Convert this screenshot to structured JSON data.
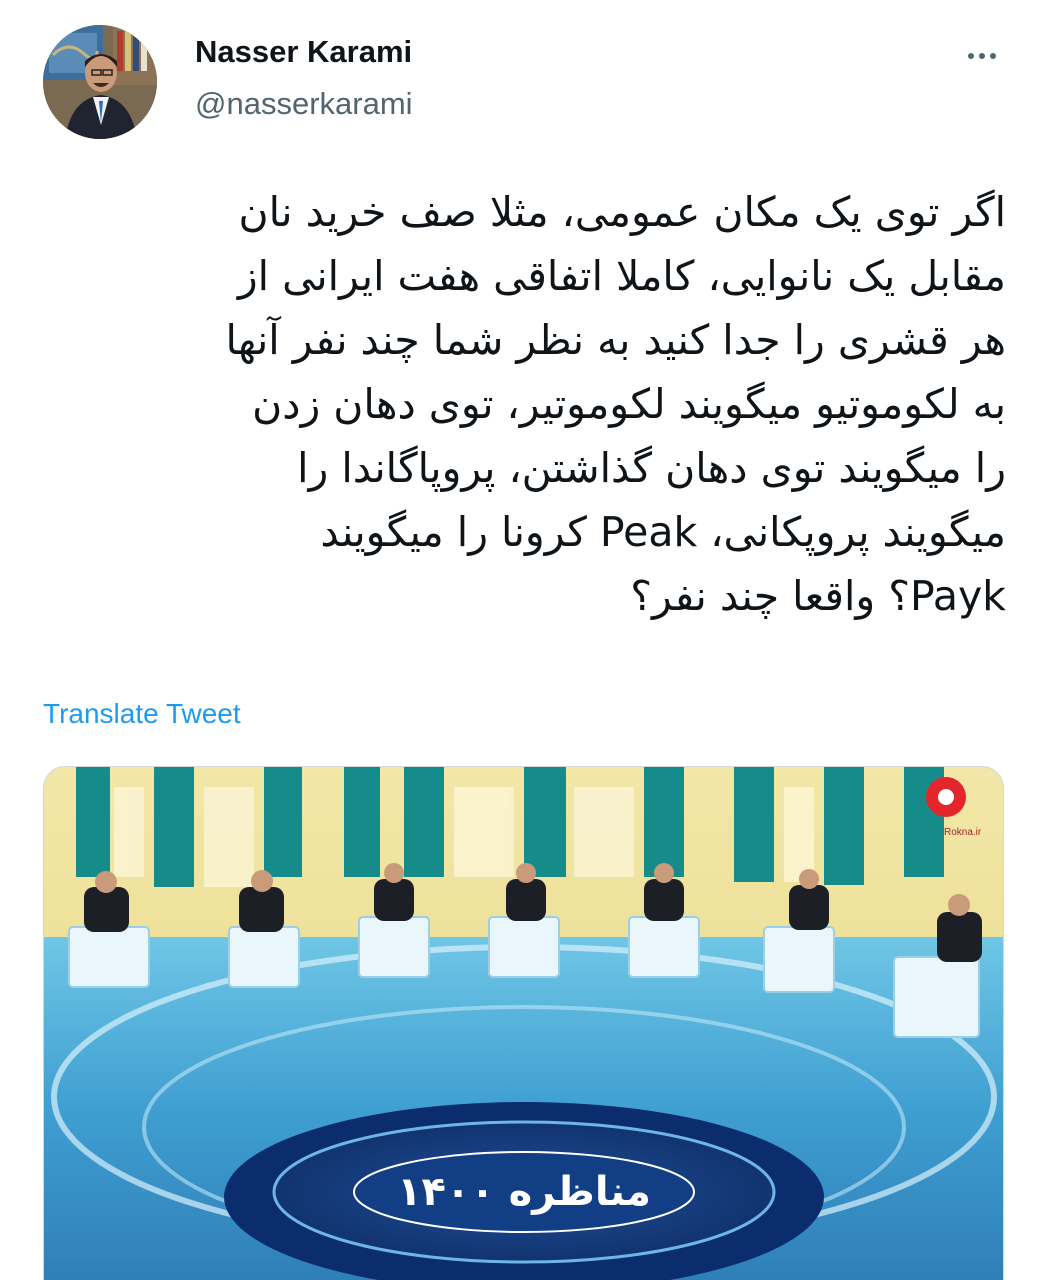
{
  "author": {
    "display_name": "Nasser Karami",
    "handle": "@nasserkarami",
    "avatar_icon": "profile-photo"
  },
  "more_icon": "more-horizontal-icon",
  "tweet": {
    "lines": [
      "اگر توی یک مکان عمومی، مثلا صف خرید نان",
      "مقابل یک نانوایی، کاملا اتفاقی هفت ایرانی از",
      "هر قشری را جدا کنید به نظر شما چند نفر آنها",
      "به لکوموتیو میگویند لکوموتیر، توی دهان زدن",
      "را میگویند توی دهان گذاشتن، پروپاگاندا را",
      "میگویند پروپکانی، Peak کرونا را میگویند",
      "Payk؟ واقعا چند نفر؟"
    ],
    "translate_label": "Translate Tweet"
  },
  "media": {
    "description_icon": "debate-photo",
    "stage_logo_text": "مناظره ۱۴۰۰",
    "watermark_text": "Rokna.ir",
    "accent": "#e3262c"
  }
}
